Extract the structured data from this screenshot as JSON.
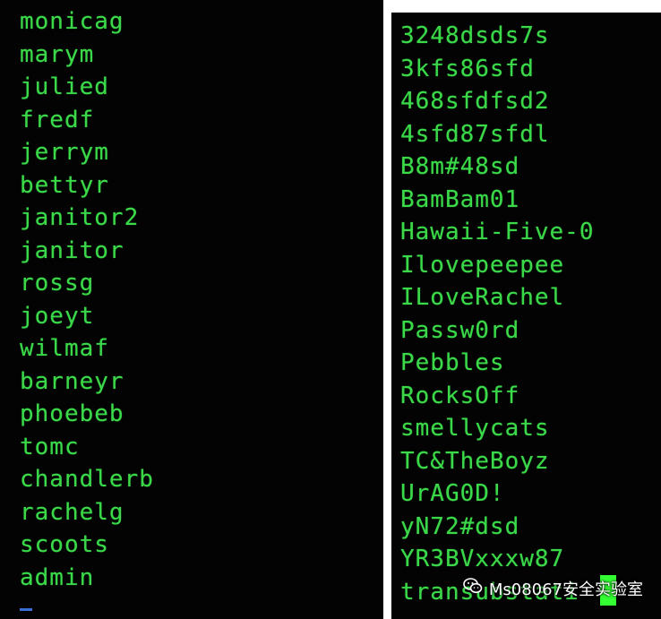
{
  "usernames": [
    "monicag",
    "marym",
    "julied",
    "fredf",
    "jerrym",
    "bettyr",
    "janitor2",
    "janitor",
    "rossg",
    "joeyt",
    "wilmaf",
    "barneyr",
    "phoebeb",
    "tomc",
    "chandlerb",
    "rachelg",
    "scoots",
    "admin"
  ],
  "passwords": [
    "3248dsds7s",
    "3kfs86sfd",
    "468sfdfsd2",
    "4sfd87sfdl",
    "B8m#48sd",
    "BamBam01",
    "Hawaii-Five-0",
    "Ilovepeepee",
    "ILoveRachel",
    "Passw0rd",
    "Pebbles",
    "RocksOff",
    "smellycats",
    "TC&TheBoyz",
    "UrAG0D!",
    "yN72#dsd",
    "YR3BVxxxw87",
    "transubstati"
  ],
  "watermark": {
    "text": "Ms08067安全实验室",
    "icon": "wechat-icon"
  },
  "colors": {
    "terminal_bg": "#030303",
    "terminal_text": "#3bd94a",
    "cursor": "#33ff33",
    "page_bg": "#ffffff"
  }
}
